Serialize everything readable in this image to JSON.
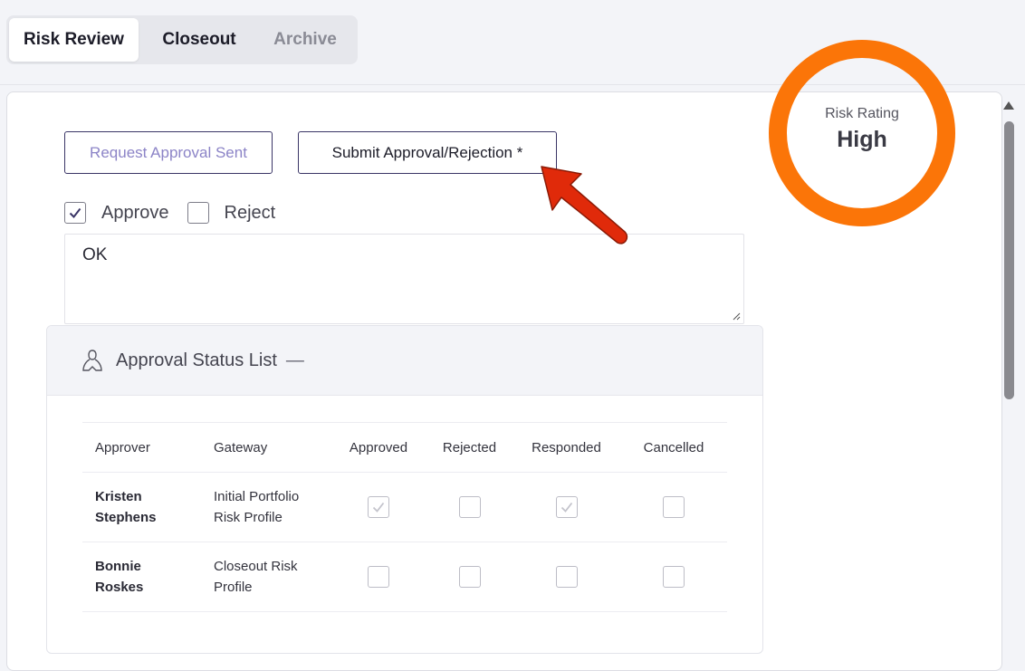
{
  "tabs": [
    {
      "label": "Risk Review",
      "active": true
    },
    {
      "label": "Closeout",
      "active": false
    },
    {
      "label": "Archive",
      "active": false
    }
  ],
  "actions": {
    "request_label": "Request Approval Sent",
    "submit_label": "Submit Approval/Rejection *"
  },
  "decision": {
    "approve_label": "Approve",
    "approve_checked": true,
    "reject_label": "Reject",
    "reject_checked": false,
    "comment": "OK"
  },
  "approval_panel": {
    "title": "Approval Status List",
    "collapse_glyph": "—",
    "icon": "user-outline-icon",
    "columns": [
      "Approver",
      "Gateway",
      "Approved",
      "Rejected",
      "Responded",
      "Cancelled"
    ],
    "rows": [
      {
        "approver": "Kristen\nStephens",
        "gateway": "Initial Portfolio\nRisk Profile",
        "approved": true,
        "rejected": false,
        "responded": true,
        "cancelled": false
      },
      {
        "approver": "Bonnie\nRoskes",
        "gateway": "Closeout Risk\nProfile",
        "approved": false,
        "rejected": false,
        "responded": false,
        "cancelled": false
      }
    ]
  },
  "risk": {
    "label": "Risk Rating",
    "value": "High",
    "ring_color": "#fb7508"
  },
  "colors": {
    "accent_border": "#3a3566",
    "request_text": "#8c84c7",
    "annotation_arrow": "#e02a0a"
  }
}
